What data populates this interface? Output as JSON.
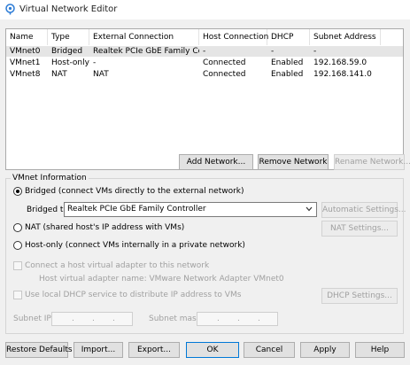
{
  "window": {
    "title": "Virtual Network Editor",
    "icon": "network-globe-icon"
  },
  "table": {
    "columns": [
      "Name",
      "Type",
      "External Connection",
      "Host Connection",
      "DHCP",
      "Subnet Address"
    ],
    "rows": [
      {
        "name": "VMnet0",
        "type": "Bridged",
        "external": "Realtek PCIe GbE Family Co...",
        "host": "-",
        "dhcp": "-",
        "subnet": "-"
      },
      {
        "name": "VMnet1",
        "type": "Host-only",
        "external": "-",
        "host": "Connected",
        "dhcp": "Enabled",
        "subnet": "192.168.59.0"
      },
      {
        "name": "VMnet8",
        "type": "NAT",
        "external": "NAT",
        "host": "Connected",
        "dhcp": "Enabled",
        "subnet": "192.168.141.0"
      }
    ],
    "selected_row": 0
  },
  "table_buttons": {
    "add": "Add Network...",
    "remove": "Remove Network",
    "rename": "Rename Network..."
  },
  "vmnet_info": {
    "group_label": "VMnet Information",
    "bridged_label": "Bridged (connect VMs directly to the external network)",
    "bridged_to_label": "Bridged to:",
    "bridged_to_value": "Realtek PCIe GbE Family Controller",
    "automatic_settings": "Automatic Settings...",
    "nat_label": "NAT (shared host's IP address with VMs)",
    "nat_settings": "NAT Settings...",
    "hostonly_label": "Host-only (connect VMs internally in a private network)",
    "selected_mode": "bridged",
    "connect_adapter_label": "Connect a host virtual adapter to this network",
    "adapter_name_label": "Host virtual adapter name: VMware Network Adapter VMnet0",
    "dhcp_label": "Use local DHCP service to distribute IP address to VMs",
    "dhcp_settings": "DHCP Settings...",
    "subnet_ip_label": "Subnet IP:",
    "subnet_mask_label": "Subnet mask:"
  },
  "bottom_buttons": {
    "restore": "Restore Defaults",
    "import": "Import...",
    "export": "Export...",
    "ok": "OK",
    "cancel": "Cancel",
    "apply": "Apply",
    "help": "Help"
  }
}
